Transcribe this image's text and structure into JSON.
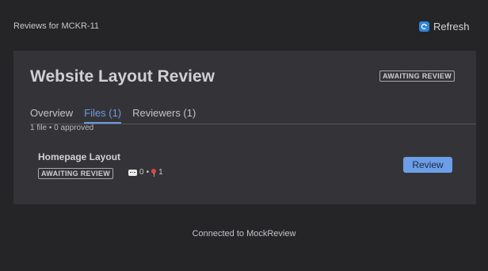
{
  "header": {
    "title": "Reviews for MCKR-11",
    "refresh_label": "Refresh",
    "refresh_icon": "refresh-icon"
  },
  "card": {
    "title": "Website Layout Review",
    "status": "AWAITING REVIEW",
    "tabs": [
      {
        "label": "Overview",
        "active": false
      },
      {
        "label": "Files (1)",
        "active": true
      },
      {
        "label": "Reviewers (1)",
        "active": false
      }
    ],
    "summary": "1 file • 0 approved",
    "files": [
      {
        "name": "Homepage Layout",
        "status": "AWAITING REVIEW",
        "comments": "0",
        "separator": "•",
        "pins": "1",
        "action_label": "Review"
      }
    ]
  },
  "footer": {
    "text": "Connected to MockReview"
  },
  "colors": {
    "background": "#252528",
    "card": "#343438",
    "accent": "#6e9ce0",
    "button": "#6d9ee8"
  }
}
